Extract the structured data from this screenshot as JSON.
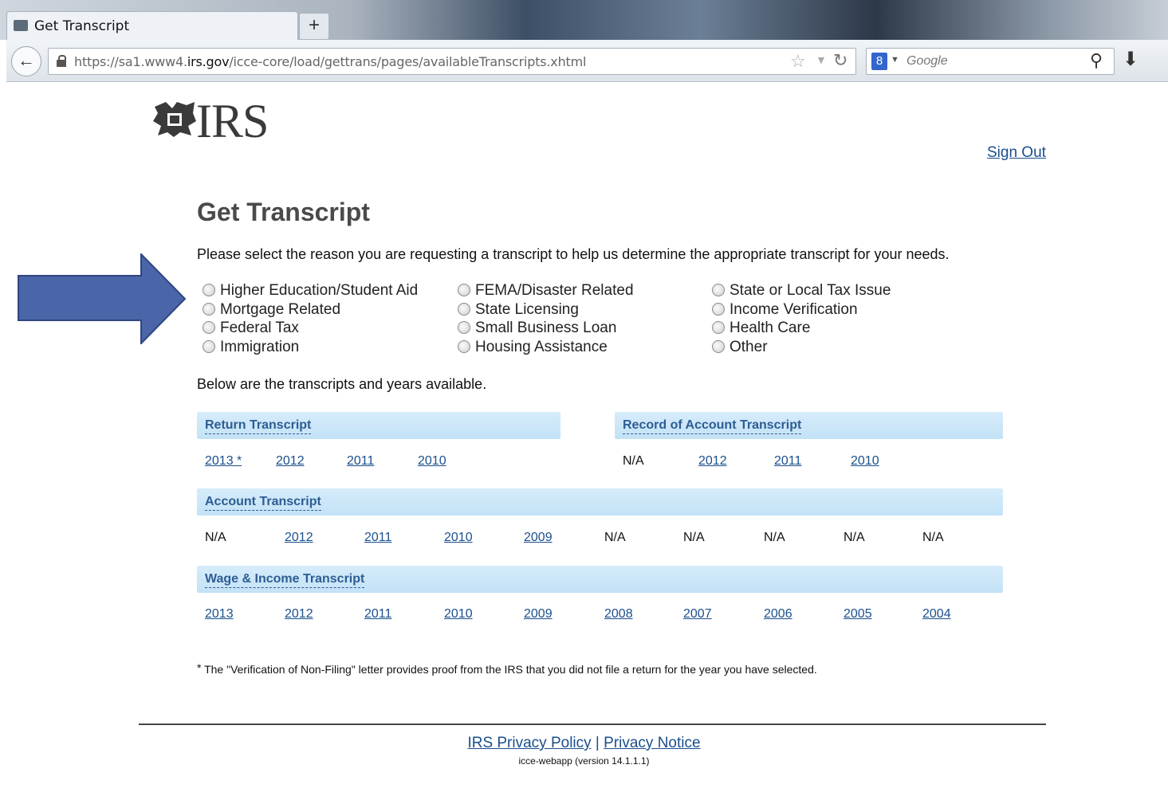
{
  "browser": {
    "tab_title": "Get Transcript",
    "new_tab_label": "+",
    "url_prefix": "https://sa1.www4.",
    "url_domain": "irs.gov",
    "url_path": "/icce-core/load/gettrans/pages/availableTranscripts.xhtml",
    "search_engine_label": "8",
    "search_placeholder": "Google",
    "icons": {
      "back": "back-arrow-icon",
      "lock": "lock-icon",
      "bookmark": "star-icon",
      "reload": "reload-icon",
      "search": "search-icon",
      "download": "download-icon"
    }
  },
  "header": {
    "logo_text": "IRS",
    "sign_out": "Sign Out"
  },
  "main": {
    "title": "Get Transcript",
    "intro": "Please select the reason you are requesting a transcript to help us determine the appropriate transcript for your needs.",
    "reasons": [
      [
        "Higher Education/Student Aid",
        "Mortgage Related",
        "Federal Tax",
        "Immigration"
      ],
      [
        "FEMA/Disaster Related",
        "State Licensing",
        "Small Business Loan",
        "Housing Assistance"
      ],
      [
        "State or Local Tax Issue",
        "Income Verification",
        "Health Care",
        "Other"
      ]
    ],
    "below_text": "Below are the transcripts and years available.",
    "return_transcript": {
      "title": "Return Transcript",
      "years": [
        "2013 *",
        "2012",
        "2011",
        "2010"
      ]
    },
    "record_of_account": {
      "title": "Record of Account Transcript",
      "na": "N/A",
      "years": [
        "2012",
        "2011",
        "2010"
      ]
    },
    "account_transcript": {
      "title": "Account Transcript",
      "cells": [
        "N/A",
        "2012",
        "2011",
        "2010",
        "2009",
        "N/A",
        "N/A",
        "N/A",
        "N/A",
        "N/A"
      ]
    },
    "wage_income": {
      "title": "Wage & Income Transcript",
      "years": [
        "2013",
        "2012",
        "2011",
        "2010",
        "2009",
        "2008",
        "2007",
        "2006",
        "2005",
        "2004"
      ]
    },
    "footnote_star": "*",
    "footnote": "The \"Verification of Non-Filing\" letter provides proof from the IRS that you did not file a return for the year you have selected."
  },
  "footer": {
    "privacy_policy": "IRS Privacy Policy",
    "separator": "|",
    "privacy_notice": "Privacy Notice",
    "version": "icce-webapp (version 14.1.1.1)"
  },
  "colors": {
    "arrow": "#4a65a8",
    "link": "#1a4f8c",
    "section_bar": "#c8e4f7"
  }
}
